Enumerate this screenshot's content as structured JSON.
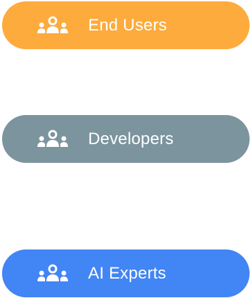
{
  "groups": [
    {
      "label": "End Users",
      "icon": "group-icon",
      "color": "#FDAB3D"
    },
    {
      "label": "Developers",
      "icon": "group-icon",
      "color": "#7C949E"
    },
    {
      "label": "AI Experts",
      "icon": "group-icon",
      "color": "#4285F4"
    }
  ]
}
